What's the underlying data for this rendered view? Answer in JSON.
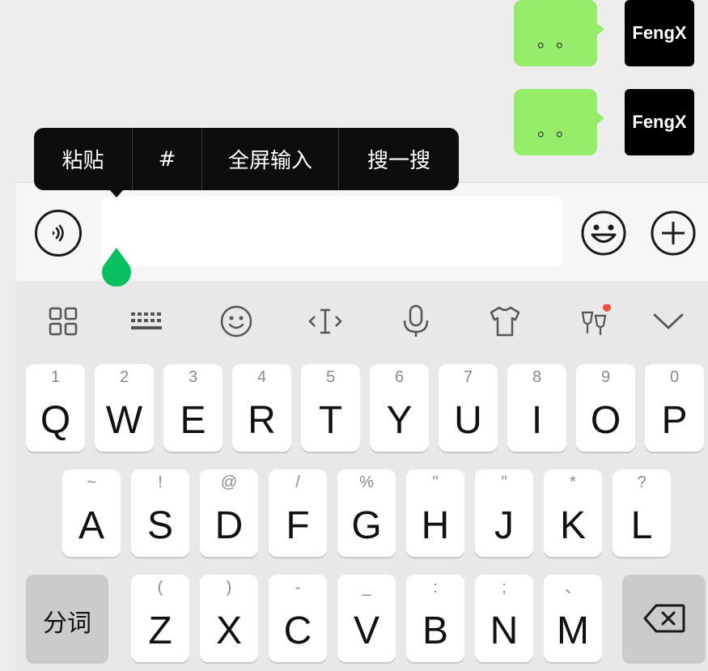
{
  "chat": {
    "messages": [
      {
        "text": "。。",
        "sender": "FengX"
      },
      {
        "text": "。。",
        "sender": "FengX"
      }
    ]
  },
  "context_menu": {
    "items": [
      "粘贴",
      "#",
      "全屏输入",
      "搜一搜"
    ]
  },
  "input_bar": {
    "value": "",
    "voice_icon": "voice-input-icon",
    "emoji_icon": "emoji-icon",
    "plus_icon": "plus-icon"
  },
  "toolbar": {
    "icons": [
      "grid-icon",
      "keyboard-icon",
      "emoji-icon",
      "cursor-move-icon",
      "microphone-icon",
      "tshirt-skin-icon",
      "wine-glasses-icon",
      "chevron-down-icon"
    ],
    "notification_badge_color": "#f04a3e"
  },
  "keyboard": {
    "row1": [
      {
        "main": "Q",
        "sub": "1"
      },
      {
        "main": "W",
        "sub": "2"
      },
      {
        "main": "E",
        "sub": "3"
      },
      {
        "main": "R",
        "sub": "4"
      },
      {
        "main": "T",
        "sub": "5"
      },
      {
        "main": "Y",
        "sub": "6"
      },
      {
        "main": "U",
        "sub": "7"
      },
      {
        "main": "I",
        "sub": "8"
      },
      {
        "main": "O",
        "sub": "9"
      },
      {
        "main": "P",
        "sub": "0"
      }
    ],
    "row2": [
      {
        "main": "A",
        "sub": "~"
      },
      {
        "main": "S",
        "sub": "!"
      },
      {
        "main": "D",
        "sub": "@"
      },
      {
        "main": "F",
        "sub": "/"
      },
      {
        "main": "G",
        "sub": "%"
      },
      {
        "main": "H",
        "sub": "\""
      },
      {
        "main": "J",
        "sub": "\""
      },
      {
        "main": "K",
        "sub": "*"
      },
      {
        "main": "L",
        "sub": "?"
      }
    ],
    "row3": [
      {
        "main": "Z",
        "sub": "("
      },
      {
        "main": "X",
        "sub": ")"
      },
      {
        "main": "C",
        "sub": "-"
      },
      {
        "main": "V",
        "sub": "_"
      },
      {
        "main": "B",
        "sub": ":"
      },
      {
        "main": "N",
        "sub": ";"
      },
      {
        "main": "M",
        "sub": "、"
      }
    ],
    "segment_label": "分词",
    "backspace_icon": "backspace-icon"
  },
  "colors": {
    "bubble": "#95ec69",
    "cursor_handle": "#07c160",
    "menu_bg": "#0d0d0d"
  }
}
